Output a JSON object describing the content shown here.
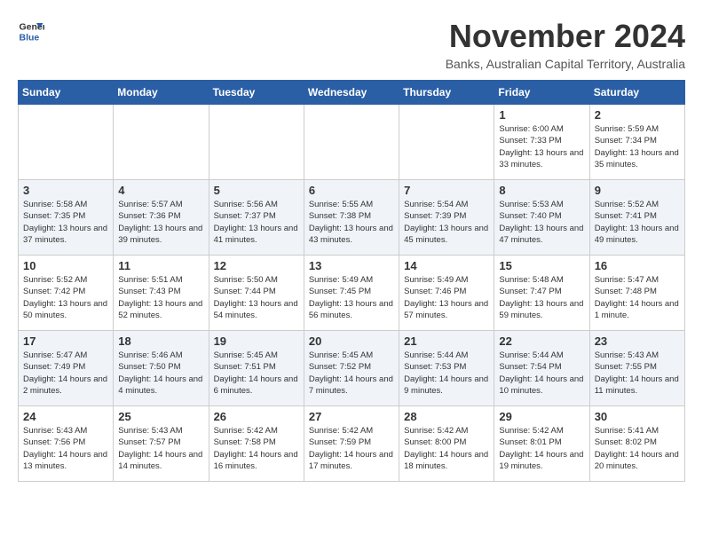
{
  "logo": {
    "general": "General",
    "blue": "Blue"
  },
  "title": {
    "month": "November 2024",
    "location": "Banks, Australian Capital Territory, Australia"
  },
  "headers": [
    "Sunday",
    "Monday",
    "Tuesday",
    "Wednesday",
    "Thursday",
    "Friday",
    "Saturday"
  ],
  "weeks": [
    [
      {
        "day": "",
        "empty": true
      },
      {
        "day": "",
        "empty": true
      },
      {
        "day": "",
        "empty": true
      },
      {
        "day": "",
        "empty": true
      },
      {
        "day": "",
        "empty": true
      },
      {
        "day": "1",
        "sunrise": "Sunrise: 6:00 AM",
        "sunset": "Sunset: 7:33 PM",
        "daylight": "Daylight: 13 hours and 33 minutes."
      },
      {
        "day": "2",
        "sunrise": "Sunrise: 5:59 AM",
        "sunset": "Sunset: 7:34 PM",
        "daylight": "Daylight: 13 hours and 35 minutes."
      }
    ],
    [
      {
        "day": "3",
        "sunrise": "Sunrise: 5:58 AM",
        "sunset": "Sunset: 7:35 PM",
        "daylight": "Daylight: 13 hours and 37 minutes."
      },
      {
        "day": "4",
        "sunrise": "Sunrise: 5:57 AM",
        "sunset": "Sunset: 7:36 PM",
        "daylight": "Daylight: 13 hours and 39 minutes."
      },
      {
        "day": "5",
        "sunrise": "Sunrise: 5:56 AM",
        "sunset": "Sunset: 7:37 PM",
        "daylight": "Daylight: 13 hours and 41 minutes."
      },
      {
        "day": "6",
        "sunrise": "Sunrise: 5:55 AM",
        "sunset": "Sunset: 7:38 PM",
        "daylight": "Daylight: 13 hours and 43 minutes."
      },
      {
        "day": "7",
        "sunrise": "Sunrise: 5:54 AM",
        "sunset": "Sunset: 7:39 PM",
        "daylight": "Daylight: 13 hours and 45 minutes."
      },
      {
        "day": "8",
        "sunrise": "Sunrise: 5:53 AM",
        "sunset": "Sunset: 7:40 PM",
        "daylight": "Daylight: 13 hours and 47 minutes."
      },
      {
        "day": "9",
        "sunrise": "Sunrise: 5:52 AM",
        "sunset": "Sunset: 7:41 PM",
        "daylight": "Daylight: 13 hours and 49 minutes."
      }
    ],
    [
      {
        "day": "10",
        "sunrise": "Sunrise: 5:52 AM",
        "sunset": "Sunset: 7:42 PM",
        "daylight": "Daylight: 13 hours and 50 minutes."
      },
      {
        "day": "11",
        "sunrise": "Sunrise: 5:51 AM",
        "sunset": "Sunset: 7:43 PM",
        "daylight": "Daylight: 13 hours and 52 minutes."
      },
      {
        "day": "12",
        "sunrise": "Sunrise: 5:50 AM",
        "sunset": "Sunset: 7:44 PM",
        "daylight": "Daylight: 13 hours and 54 minutes."
      },
      {
        "day": "13",
        "sunrise": "Sunrise: 5:49 AM",
        "sunset": "Sunset: 7:45 PM",
        "daylight": "Daylight: 13 hours and 56 minutes."
      },
      {
        "day": "14",
        "sunrise": "Sunrise: 5:49 AM",
        "sunset": "Sunset: 7:46 PM",
        "daylight": "Daylight: 13 hours and 57 minutes."
      },
      {
        "day": "15",
        "sunrise": "Sunrise: 5:48 AM",
        "sunset": "Sunset: 7:47 PM",
        "daylight": "Daylight: 13 hours and 59 minutes."
      },
      {
        "day": "16",
        "sunrise": "Sunrise: 5:47 AM",
        "sunset": "Sunset: 7:48 PM",
        "daylight": "Daylight: 14 hours and 1 minute."
      }
    ],
    [
      {
        "day": "17",
        "sunrise": "Sunrise: 5:47 AM",
        "sunset": "Sunset: 7:49 PM",
        "daylight": "Daylight: 14 hours and 2 minutes."
      },
      {
        "day": "18",
        "sunrise": "Sunrise: 5:46 AM",
        "sunset": "Sunset: 7:50 PM",
        "daylight": "Daylight: 14 hours and 4 minutes."
      },
      {
        "day": "19",
        "sunrise": "Sunrise: 5:45 AM",
        "sunset": "Sunset: 7:51 PM",
        "daylight": "Daylight: 14 hours and 6 minutes."
      },
      {
        "day": "20",
        "sunrise": "Sunrise: 5:45 AM",
        "sunset": "Sunset: 7:52 PM",
        "daylight": "Daylight: 14 hours and 7 minutes."
      },
      {
        "day": "21",
        "sunrise": "Sunrise: 5:44 AM",
        "sunset": "Sunset: 7:53 PM",
        "daylight": "Daylight: 14 hours and 9 minutes."
      },
      {
        "day": "22",
        "sunrise": "Sunrise: 5:44 AM",
        "sunset": "Sunset: 7:54 PM",
        "daylight": "Daylight: 14 hours and 10 minutes."
      },
      {
        "day": "23",
        "sunrise": "Sunrise: 5:43 AM",
        "sunset": "Sunset: 7:55 PM",
        "daylight": "Daylight: 14 hours and 11 minutes."
      }
    ],
    [
      {
        "day": "24",
        "sunrise": "Sunrise: 5:43 AM",
        "sunset": "Sunset: 7:56 PM",
        "daylight": "Daylight: 14 hours and 13 minutes."
      },
      {
        "day": "25",
        "sunrise": "Sunrise: 5:43 AM",
        "sunset": "Sunset: 7:57 PM",
        "daylight": "Daylight: 14 hours and 14 minutes."
      },
      {
        "day": "26",
        "sunrise": "Sunrise: 5:42 AM",
        "sunset": "Sunset: 7:58 PM",
        "daylight": "Daylight: 14 hours and 16 minutes."
      },
      {
        "day": "27",
        "sunrise": "Sunrise: 5:42 AM",
        "sunset": "Sunset: 7:59 PM",
        "daylight": "Daylight: 14 hours and 17 minutes."
      },
      {
        "day": "28",
        "sunrise": "Sunrise: 5:42 AM",
        "sunset": "Sunset: 8:00 PM",
        "daylight": "Daylight: 14 hours and 18 minutes."
      },
      {
        "day": "29",
        "sunrise": "Sunrise: 5:42 AM",
        "sunset": "Sunset: 8:01 PM",
        "daylight": "Daylight: 14 hours and 19 minutes."
      },
      {
        "day": "30",
        "sunrise": "Sunrise: 5:41 AM",
        "sunset": "Sunset: 8:02 PM",
        "daylight": "Daylight: 14 hours and 20 minutes."
      }
    ]
  ]
}
